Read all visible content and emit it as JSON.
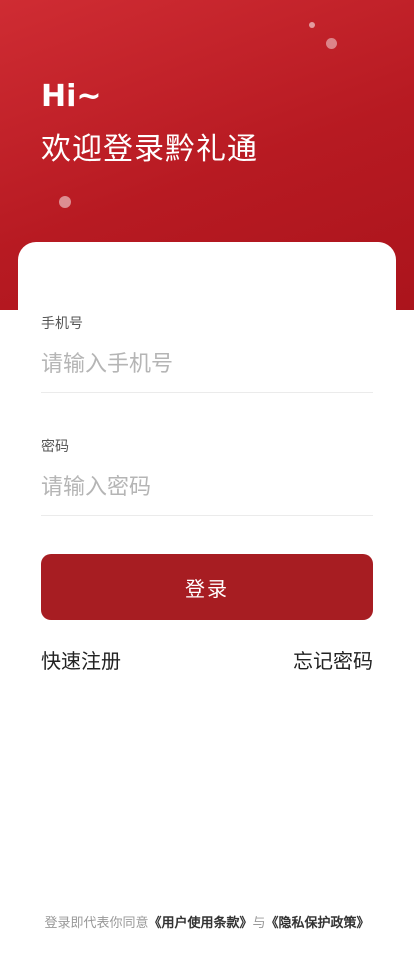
{
  "header": {
    "greeting": "Hi~",
    "title": "欢迎登录黔礼通"
  },
  "form": {
    "phone_label": "手机号",
    "phone_placeholder": "请输入手机号",
    "phone_value": "",
    "password_label": "密码",
    "password_placeholder": "请输入密码",
    "password_value": "",
    "login_label": "登录"
  },
  "links": {
    "register": "快速注册",
    "forgot": "忘记密码"
  },
  "agreement": {
    "prefix": "登录即代表你同意",
    "terms": "《用户使用条款》",
    "connector": "与",
    "privacy": "《隐私保护政策》"
  },
  "colors": {
    "brand": "#b71a22",
    "button": "#a71d22"
  }
}
